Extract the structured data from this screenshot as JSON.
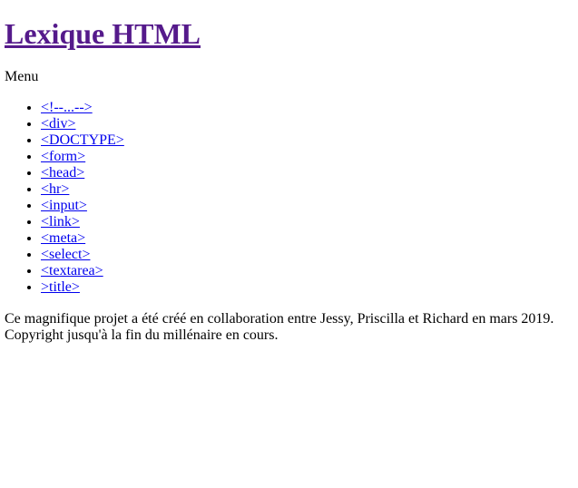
{
  "header": {
    "title": "Lexique HTML"
  },
  "menu": {
    "label": "Menu",
    "items": [
      {
        "label": "<!--...-->"
      },
      {
        "label": "<div>"
      },
      {
        "label": "<DOCTYPE>"
      },
      {
        "label": "<form>"
      },
      {
        "label": "<head>"
      },
      {
        "label": "<hr>"
      },
      {
        "label": "<input>"
      },
      {
        "label": "<link>"
      },
      {
        "label": "<meta>"
      },
      {
        "label": "<select>"
      },
      {
        "label": "<textarea>"
      },
      {
        "label": ">title>"
      }
    ]
  },
  "footer": {
    "line1": "Ce magnifique projet a été créé en collaboration entre Jessy, Priscilla et Richard en mars 2019.",
    "line2": "Copyright jusqu'à la fin du millénaire en cours."
  },
  "colors": {
    "visited_link": "#551a8b",
    "link": "#0000ee",
    "text": "#000000",
    "background": "#ffffff"
  }
}
